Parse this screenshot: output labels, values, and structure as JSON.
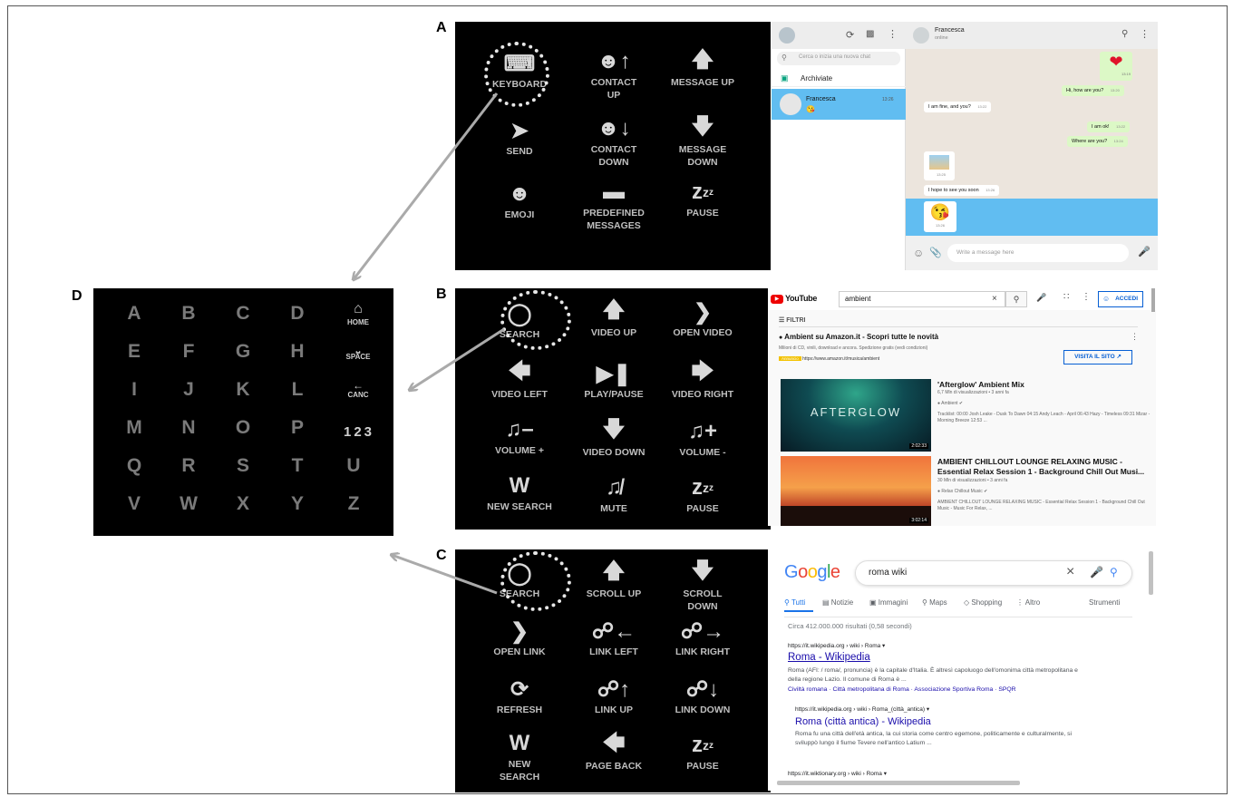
{
  "panel_labels": {
    "a": "A",
    "b": "B",
    "c": "C",
    "d": "D"
  },
  "panel_a": {
    "commands": [
      {
        "label": "KEYBOARD",
        "icon": "keyboard-icon"
      },
      {
        "label": "CONTACT\nUP",
        "icon": "contact-up-icon"
      },
      {
        "label": "MESSAGE UP",
        "icon": "arrow-up-icon"
      },
      {
        "label": "SEND",
        "icon": "send-icon"
      },
      {
        "label": "CONTACT\nDOWN",
        "icon": "contact-down-icon"
      },
      {
        "label": "MESSAGE\nDOWN",
        "icon": "arrow-down-icon"
      },
      {
        "label": "EMOJI",
        "icon": "emoji-icon"
      },
      {
        "label": "PREDEFINED\nMESSAGES",
        "icon": "speech-bubble-icon"
      },
      {
        "label": "PAUSE",
        "icon": "zzz-icon"
      }
    ],
    "whatsapp": {
      "search_placeholder": "Cerca o inizia una nuova chat",
      "archived": "Archiviate",
      "contact_name": "Francesca",
      "contact_time": "13:26",
      "header_name": "Francesca",
      "header_status": "online",
      "messages": [
        {
          "text": "Hi, how are you?",
          "time": "13:20",
          "out": true
        },
        {
          "text": "I am fine, and you?",
          "time": "13:22",
          "out": false
        },
        {
          "text": "I am ok!",
          "time": "13:22",
          "out": true
        },
        {
          "text": "Where are you?",
          "time": "13:24",
          "out": true
        },
        {
          "text": "I hope to see you soon",
          "time": "13:26",
          "out": false
        }
      ],
      "time_heart": "13:19",
      "time_img": "13:25",
      "time_emoji": "13:26",
      "input_placeholder": "Write a message here"
    }
  },
  "panel_b": {
    "commands": [
      {
        "label": "SEARCH",
        "icon": "search-icon"
      },
      {
        "label": "VIDEO UP",
        "icon": "arrow-up-icon"
      },
      {
        "label": "OPEN VIDEO",
        "icon": "chevron-right-icon"
      },
      {
        "label": "VIDEO LEFT",
        "icon": "arrow-left-icon"
      },
      {
        "label": "PLAY/PAUSE",
        "icon": "play-pause-icon"
      },
      {
        "label": "VIDEO RIGHT",
        "icon": "arrow-right-icon"
      },
      {
        "label": "VOLUME +",
        "icon": "volume-minus-icon"
      },
      {
        "label": "VIDEO DOWN",
        "icon": "arrow-down-icon"
      },
      {
        "label": "VOLUME -",
        "icon": "volume-plus-icon"
      },
      {
        "label": "NEW SEARCH",
        "icon": "w-icon"
      },
      {
        "label": "MUTE",
        "icon": "mute-icon"
      },
      {
        "label": "PAUSE",
        "icon": "zzz-icon"
      }
    ],
    "youtube": {
      "search_value": "ambient",
      "signin": "ACCEDI",
      "filters": "FILTRI",
      "ad_title": "Ambient su Amazon.it - Scopri tutte le novità",
      "ad_desc": "Milioni di CD, vinili, download e ancora. Spedizione gratis (vedi condizioni)",
      "ad_badge": "Annuncio",
      "ad_url": "https://www.amazon.it/musica/ambient",
      "ad_button": "VISITA IL SITO",
      "videos": [
        {
          "title": "'Afterglow' Ambient Mix",
          "meta": "6,7 Mln di visualizzazioni • 3 anni fa",
          "channel": "Ambient",
          "desc": "Tracklist: 00:00 Josh Leake - Dusk To Dawn 04:15 Andy Leach - April 06:43 Hazy - Timeless 09:31 Mizar - Morning Breeze 12:53 ...",
          "duration": "2:02:33",
          "thumb_text": "AFTERGLOW"
        },
        {
          "title": "AMBIENT CHILLOUT LOUNGE RELAXING MUSIC - Essential Relax Session 1 - Background Chill Out Musi...",
          "meta": "30 Mln di visualizzazioni • 3 anni fa",
          "channel": "Relax Chillout Music",
          "desc": "AMBIENT CHILLOUT LOUNGE RELAXING MUSIC - Essential Relax Session 1 - Background Chill Out Music - Music For Relax, ...",
          "duration": "3:02:14",
          "thumb_text": ""
        }
      ]
    }
  },
  "panel_c": {
    "commands": [
      {
        "label": "SEARCH",
        "icon": "search-icon"
      },
      {
        "label": "SCROLL UP",
        "icon": "arrow-up-icon"
      },
      {
        "label": "SCROLL\nDOWN",
        "icon": "arrow-down-icon"
      },
      {
        "label": "OPEN LINK",
        "icon": "chevron-right-icon"
      },
      {
        "label": "LINK LEFT",
        "icon": "link-left-icon"
      },
      {
        "label": "LINK RIGHT",
        "icon": "link-right-icon"
      },
      {
        "label": "REFRESH",
        "icon": "refresh-icon"
      },
      {
        "label": "LINK UP",
        "icon": "link-up-icon"
      },
      {
        "label": "LINK DOWN",
        "icon": "link-down-icon"
      },
      {
        "label": "NEW\nSEARCH",
        "icon": "w-icon"
      },
      {
        "label": "PAGE BACK",
        "icon": "arrow-left-icon"
      },
      {
        "label": "PAUSE",
        "icon": "zzz-icon"
      }
    ],
    "google": {
      "logo": "Google",
      "query": "roma wiki",
      "tabs": [
        "Tutti",
        "Notizie",
        "Immagini",
        "Maps",
        "Shopping",
        "Altro"
      ],
      "tools": "Strumenti",
      "stats": "Circa 412.000.000 risultati (0,58 secondi)",
      "results": [
        {
          "url": "https://it.wikipedia.org › wiki › Roma",
          "title": "Roma - Wikipedia",
          "snippet": "Roma (AFI: / roma/, pronuncia) è la capitale d'Italia. È altresì capoluogo dell'omonima città metropolitana e della regione Lazio. Il comune di Roma è ...",
          "links": "Civiltà romana · Città metropolitana di Roma · Associazione Sportiva Roma · SPQR"
        },
        {
          "url": "https://it.wikipedia.org › wiki › Roma_(città_antica)",
          "title": "Roma (città antica) - Wikipedia",
          "snippet": "Roma fu una città dell'età antica, la cui storia come centro egemone, politicamente e culturalmente, si sviluppò lungo il fiume Tevere nell'antico Latium ...",
          "links": ""
        }
      ],
      "next_url": "https://it.wiktionary.org › wiki › Roma"
    }
  },
  "panel_d": {
    "rows": [
      [
        "A",
        "B",
        "C",
        "D"
      ],
      [
        "E",
        "F",
        "G",
        "H"
      ],
      [
        "I",
        "J",
        "K",
        "L"
      ],
      [
        "M",
        "N",
        "O",
        "P"
      ],
      [
        "Q",
        "R",
        "S",
        "T",
        "U"
      ],
      [
        "V",
        "W",
        "X",
        "Y",
        "Z"
      ]
    ],
    "special": {
      "home": "HOME",
      "space": "SPACE",
      "canc": "CANC",
      "numbers": "123"
    }
  },
  "colors": {
    "arrow": "#aaaaaa",
    "panel_bg": "#000000",
    "wa_selected": "#61bdf1",
    "wa_out": "#dcf8c6",
    "link": "#1a0dab"
  }
}
